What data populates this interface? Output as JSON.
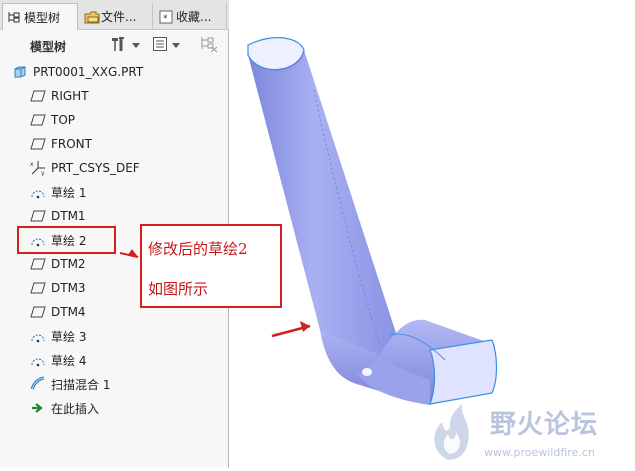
{
  "tabs": [
    {
      "label": "模型树",
      "icon": "model-tree-icon",
      "active": true
    },
    {
      "label": "文件...",
      "icon": "folder-icon",
      "active": false
    },
    {
      "label": "收藏...",
      "icon": "favorites-icon",
      "active": false
    }
  ],
  "toolbar": {
    "title": "模型树",
    "settings_icon": "tools-icon",
    "list_icon": "list-view-icon",
    "filter_icon": "tree-filter-icon"
  },
  "tree": {
    "items": [
      {
        "label": "PRT0001_XXG.PRT",
        "icon": "part-icon"
      },
      {
        "label": "RIGHT",
        "icon": "datum-plane-icon"
      },
      {
        "label": "TOP",
        "icon": "datum-plane-icon"
      },
      {
        "label": "FRONT",
        "icon": "datum-plane-icon"
      },
      {
        "label": "PRT_CSYS_DEF",
        "icon": "coordinate-system-icon"
      },
      {
        "label": "草绘 1",
        "icon": "sketch-icon"
      },
      {
        "label": "DTM1",
        "icon": "datum-plane-icon"
      },
      {
        "label": "草绘 2",
        "icon": "sketch-icon"
      },
      {
        "label": "DTM2",
        "icon": "datum-plane-icon"
      },
      {
        "label": "DTM3",
        "icon": "datum-plane-icon"
      },
      {
        "label": "DTM4",
        "icon": "datum-plane-icon"
      },
      {
        "label": "草绘 3",
        "icon": "sketch-icon"
      },
      {
        "label": "草绘 4",
        "icon": "sketch-icon"
      },
      {
        "label": "扫描混合 1",
        "icon": "swept-blend-icon"
      },
      {
        "label": "在此插入",
        "icon": "insert-here-arrow-icon"
      }
    ]
  },
  "annotation": {
    "line1": "修改后的草绘2",
    "line2": "如图所示",
    "color": "#d41f1f"
  },
  "watermark": {
    "title": "野火论坛",
    "url": "www.proewildfire.cn"
  },
  "colors": {
    "model_surface": "#9ea6ee",
    "model_edge": "#3a8fe0"
  }
}
